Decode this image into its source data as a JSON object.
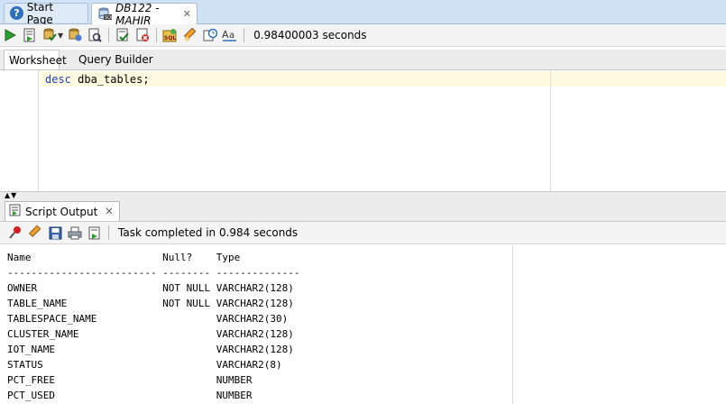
{
  "tabs": [
    {
      "label": "Start Page",
      "icon": "help-icon"
    },
    {
      "label": "DB122 - MAHIR",
      "icon": "database-sql-icon"
    }
  ],
  "toolbar": {
    "execution_time": "0.98400003 seconds"
  },
  "subtabs": [
    {
      "label": "Worksheet"
    },
    {
      "label": "Query Builder"
    }
  ],
  "editor": {
    "keyword": "desc",
    "rest": " dba_tables;"
  },
  "output": {
    "tab_label": "Script Output",
    "status": "Task completed in 0.984 seconds",
    "header": [
      "Name",
      "Null?",
      "Type"
    ],
    "underline": [
      "-------------------------",
      "--------",
      "--------------"
    ],
    "rows": [
      [
        "OWNER",
        "NOT NULL",
        "VARCHAR2(128)"
      ],
      [
        "TABLE_NAME",
        "NOT NULL",
        "VARCHAR2(128)"
      ],
      [
        "TABLESPACE_NAME",
        "",
        "VARCHAR2(30)"
      ],
      [
        "CLUSTER_NAME",
        "",
        "VARCHAR2(128)"
      ],
      [
        "IOT_NAME",
        "",
        "VARCHAR2(128)"
      ],
      [
        "STATUS",
        "",
        "VARCHAR2(8)"
      ],
      [
        "PCT_FREE",
        "",
        "NUMBER"
      ],
      [
        "PCT_USED",
        "",
        "NUMBER"
      ]
    ]
  }
}
